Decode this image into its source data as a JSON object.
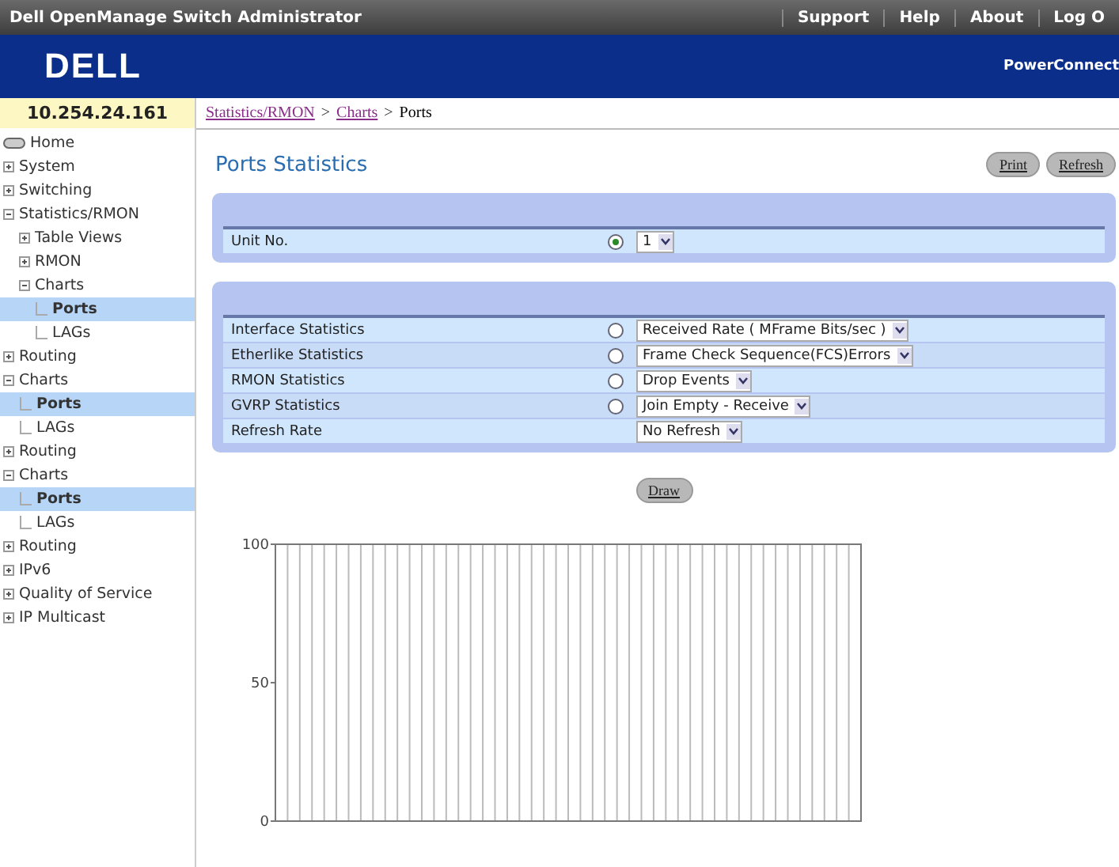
{
  "top_bar": {
    "title": "Dell OpenManage Switch Administrator",
    "links": [
      "Support",
      "Help",
      "About",
      "Log O"
    ]
  },
  "banner": {
    "logo": "DELL",
    "product": "PowerConnect"
  },
  "device_ip": "10.254.24.161",
  "breadcrumb": [
    {
      "label": "Statistics/RMON",
      "link": true
    },
    {
      "separator": ">",
      "label": "Charts",
      "link": true
    },
    {
      "separator": ">",
      "label": "Ports",
      "link": false
    }
  ],
  "sidebar": {
    "items": [
      {
        "label": "Home",
        "kind": "root",
        "selected": false
      },
      {
        "label": "System",
        "kind": "folder",
        "expanded": false,
        "selected": false
      },
      {
        "label": "Switching",
        "kind": "folder",
        "expanded": false,
        "selected": false
      },
      {
        "label": "Statistics/RMON",
        "kind": "folder",
        "expanded": true,
        "selected": false,
        "children": [
          {
            "label": "Table Views",
            "kind": "folder",
            "expanded": false,
            "selected": false
          },
          {
            "label": "RMON",
            "kind": "folder",
            "expanded": false,
            "selected": false
          },
          {
            "label": "Charts",
            "kind": "folder",
            "expanded": true,
            "selected": false,
            "children": [
              {
                "label": "Ports",
                "kind": "leaf",
                "selected": true
              },
              {
                "label": "LAGs",
                "kind": "leaf",
                "selected": false
              }
            ]
          }
        ]
      },
      {
        "label": "Routing",
        "kind": "folder",
        "expanded": false,
        "selected": false
      },
      {
        "label": "Charts",
        "kind": "folder",
        "expanded": true,
        "selected": false,
        "children": [
          {
            "label": "Ports",
            "kind": "leaf",
            "selected": true
          },
          {
            "label": "LAGs",
            "kind": "leaf",
            "selected": false
          }
        ]
      },
      {
        "label": "Routing",
        "kind": "folder",
        "expanded": false,
        "selected": false
      },
      {
        "label": "Charts",
        "kind": "folder",
        "expanded": true,
        "selected": false,
        "children": [
          {
            "label": "Ports",
            "kind": "leaf",
            "selected": true
          },
          {
            "label": "LAGs",
            "kind": "leaf",
            "selected": false
          }
        ]
      },
      {
        "label": "Routing",
        "kind": "folder",
        "expanded": false,
        "selected": false
      },
      {
        "label": "IPv6",
        "kind": "folder",
        "expanded": false,
        "selected": false
      },
      {
        "label": "Quality of Service",
        "kind": "folder",
        "expanded": false,
        "selected": false
      },
      {
        "label": "IP Multicast",
        "kind": "folder",
        "expanded": false,
        "selected": false
      }
    ]
  },
  "page_title": "Ports Statistics",
  "page_buttons": [
    "Print",
    "Refresh"
  ],
  "unit_panel": [
    {
      "label": "Unit No.",
      "radio": true,
      "selected": true,
      "value": "1"
    }
  ],
  "stats_panel": [
    {
      "label": "Interface Statistics",
      "radio": true,
      "selected": false,
      "value": "Received Rate ( MFrame Bits/sec )"
    },
    {
      "label": "Etherlike Statistics",
      "radio": true,
      "selected": false,
      "value": "Frame Check Sequence(FCS)Errors"
    },
    {
      "label": "RMON Statistics",
      "radio": true,
      "selected": false,
      "value": "Drop Events"
    },
    {
      "label": "GVRP Statistics",
      "radio": true,
      "selected": false,
      "value": "Join Empty - Receive"
    },
    {
      "label": "Refresh Rate",
      "radio": false,
      "value": "No Refresh"
    }
  ],
  "draw_button": "Draw",
  "chart": {
    "y_labels": [
      "100",
      "50",
      "0"
    ]
  }
}
